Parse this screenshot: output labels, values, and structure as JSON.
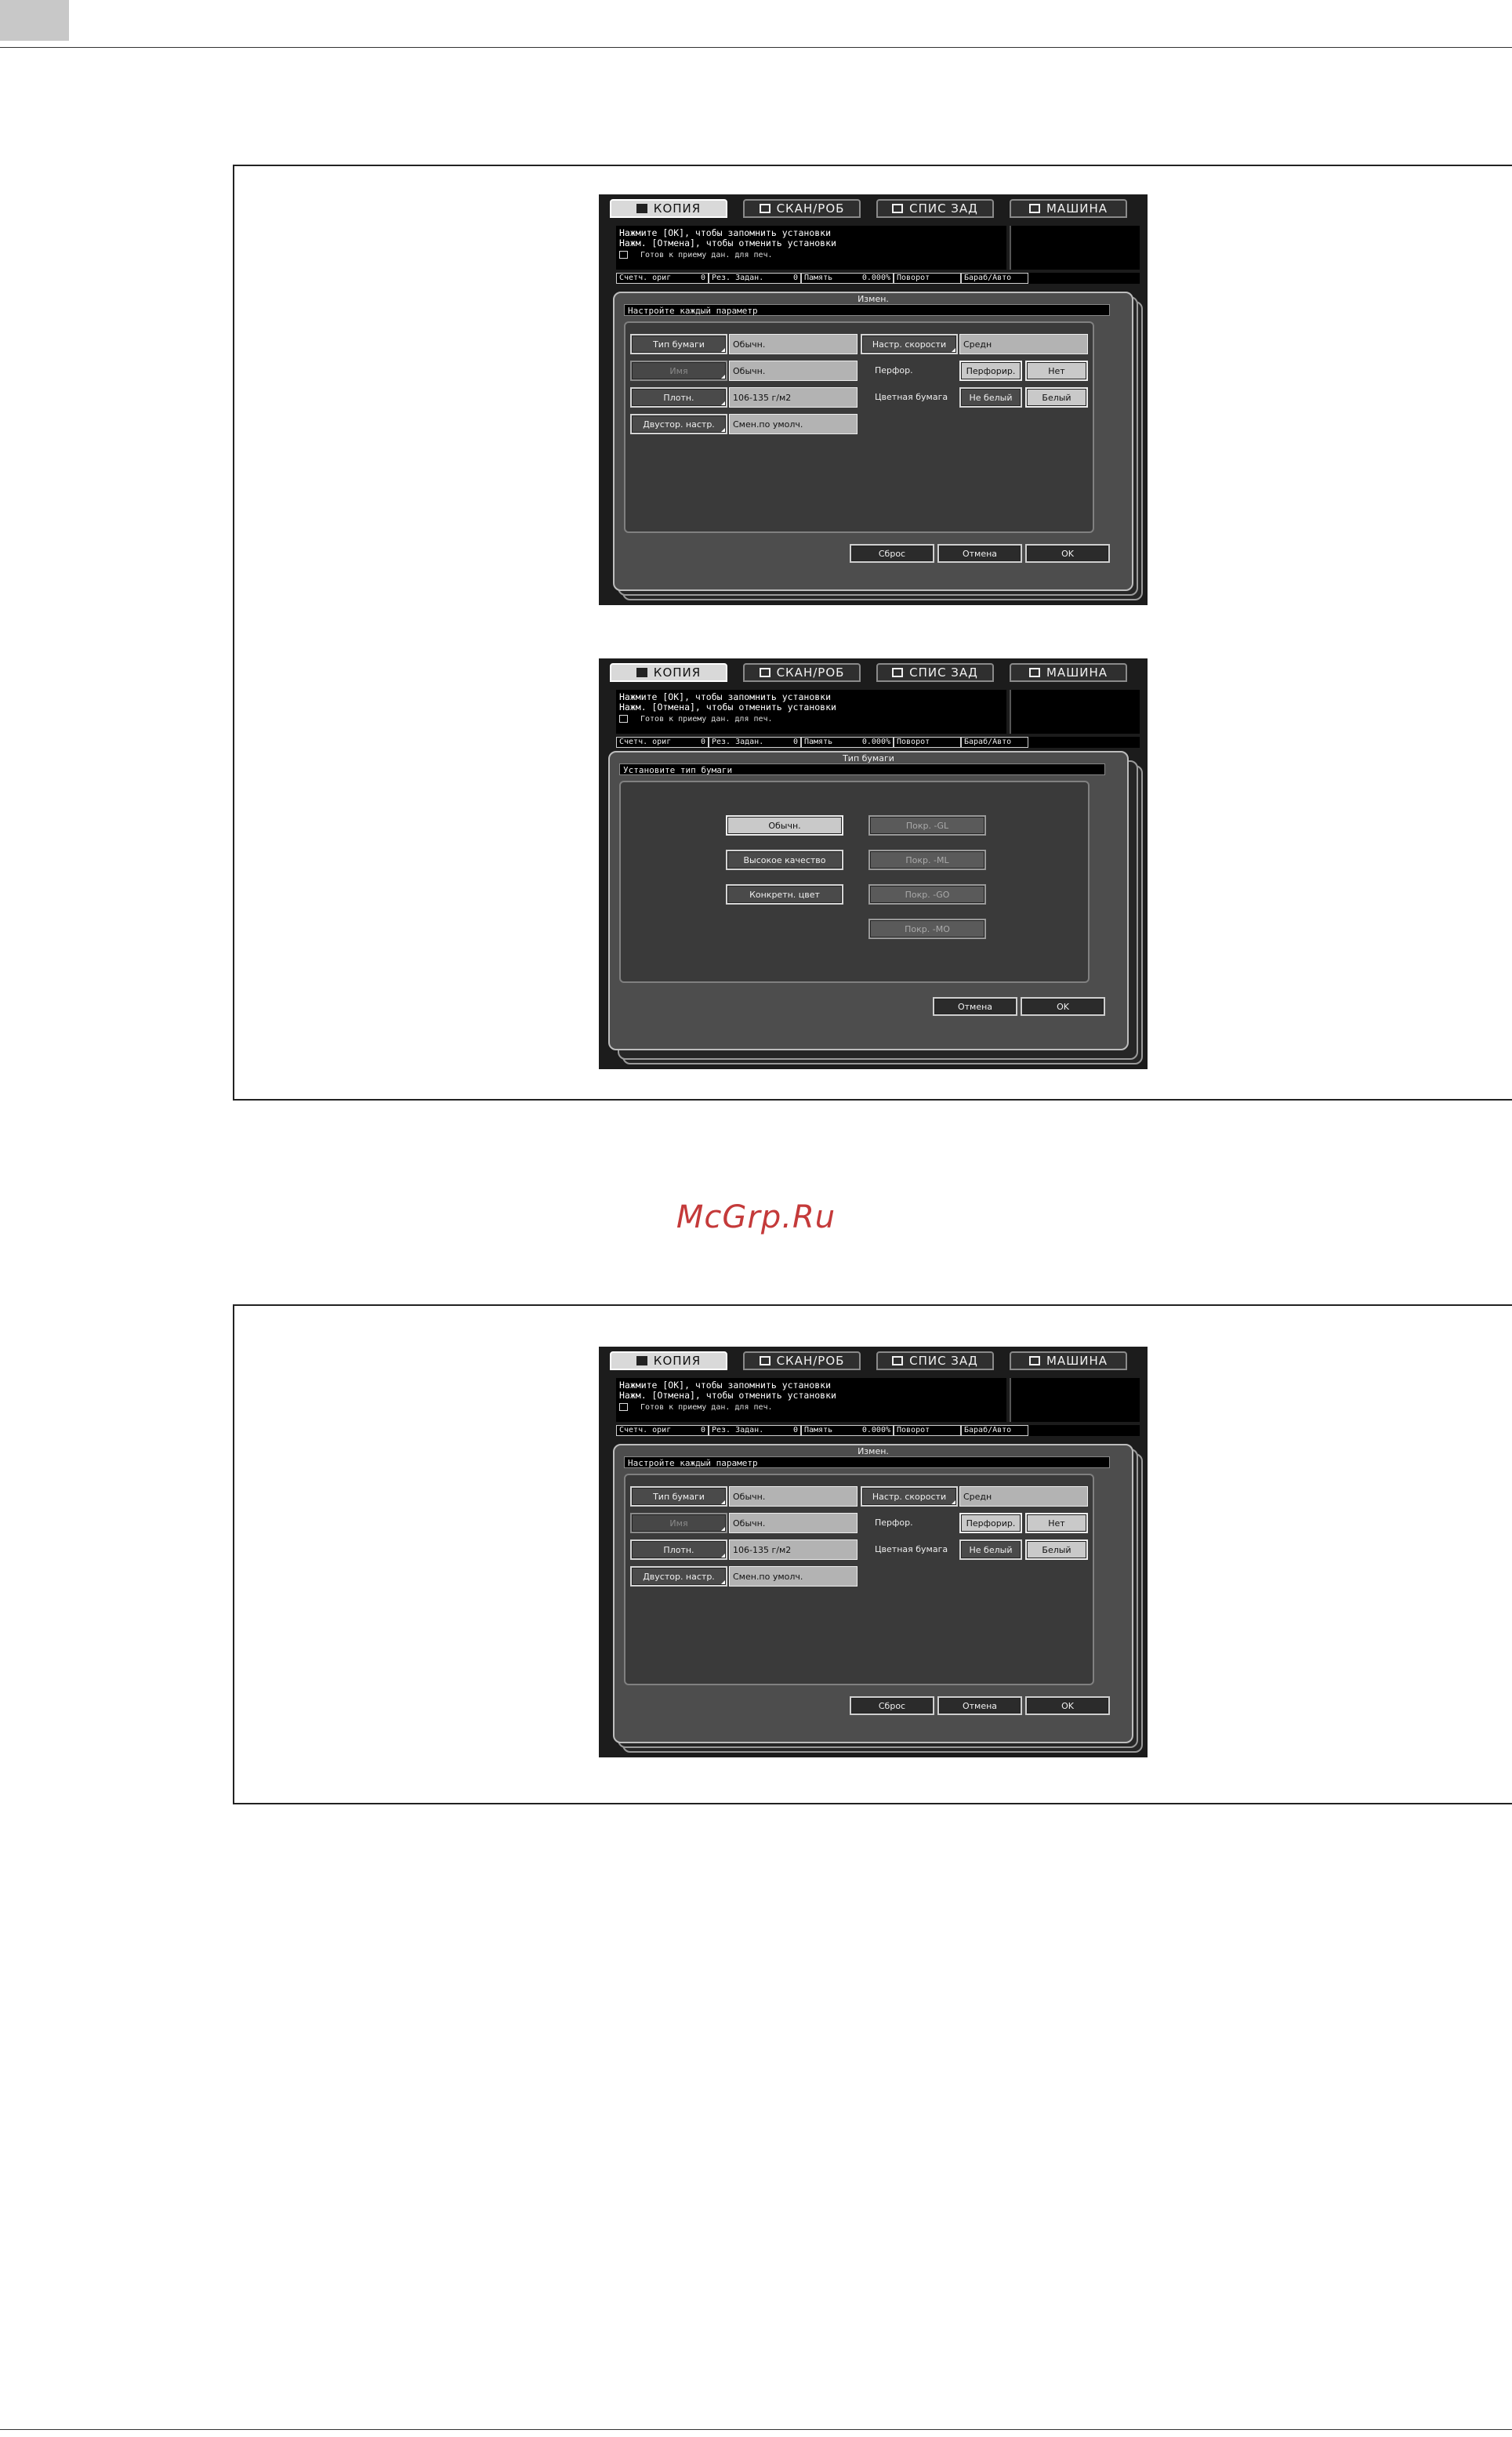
{
  "panels": [
    {
      "tabs": [
        {
          "label": "КОПИЯ",
          "icon": "copy-icon",
          "active": true
        },
        {
          "label": "СКАН/РОБ",
          "icon": "scan-icon",
          "active": false
        },
        {
          "label": "СПИС ЗАД",
          "icon": "job-list-icon",
          "active": false
        },
        {
          "label": "МАШИНА",
          "icon": "machine-icon",
          "active": false
        }
      ],
      "messages": {
        "line1": "Нажмите [OK], чтобы запомнить установки",
        "line2": "Нажм. [Отмена], чтобы отменить установки",
        "status": "Готов к приему дан. для печ."
      },
      "statusbar": {
        "orig_label": "Счетч. ориг",
        "orig_value": "0",
        "jobs_label": "Рез. Задан.",
        "jobs_value": "0",
        "memory_label": "Память",
        "memory_value": "0.000%",
        "rotate_label": "Поворот",
        "drum_label": "Бараб/Авто"
      },
      "dialog": {
        "title": "Измен.",
        "instruction": "Настройте каждый параметр",
        "rows": [
          {
            "button": "Тип бумаги",
            "value": "Обычн."
          },
          {
            "button": "Имя",
            "value": "Обычн."
          },
          {
            "button": "Плотн.",
            "value": "106-135 г/м2"
          },
          {
            "button": "Двустор. настр.",
            "value": "Смен.по умолч."
          }
        ],
        "speed_button": "Настр. скорости",
        "speed_value": "Средн",
        "punch_label": "Перфор.",
        "punch_option1": "Перфорир.",
        "punch_option2": "Нет",
        "color_label": "Цветная бумага",
        "color_option1": "Не белый",
        "color_option2": "Белый",
        "reset": "Сброс",
        "cancel": "Отмена",
        "ok": "OK"
      }
    },
    {
      "tabs": [
        {
          "label": "КОПИЯ",
          "icon": "copy-icon",
          "active": true
        },
        {
          "label": "СКАН/РОБ",
          "icon": "scan-icon",
          "active": false
        },
        {
          "label": "СПИС ЗАД",
          "icon": "job-list-icon",
          "active": false
        },
        {
          "label": "МАШИНА",
          "icon": "machine-icon",
          "active": false
        }
      ],
      "messages": {
        "line1": "Нажмите [OK], чтобы запомнить установки",
        "line2": "Нажм. [Отмена], чтобы отменить установки",
        "status": "Готов к приему дан. для печ."
      },
      "statusbar": {
        "orig_label": "Счетч. ориг",
        "orig_value": "0",
        "jobs_label": "Рез. Задан.",
        "jobs_value": "0",
        "memory_label": "Память",
        "memory_value": "0.000%",
        "rotate_label": "Поворот",
        "drum_label": "Бараб/Авто"
      },
      "dialog": {
        "title": "Тип бумаги",
        "instruction": "Установите тип бумаги",
        "types_left": [
          "Обычн.",
          "Высокое качество",
          "Конкретн. цвет"
        ],
        "types_right": [
          "Покр. -GL",
          "Покр. -ML",
          "Покр. -GO",
          "Покр. -MO"
        ],
        "cancel": "Отмена",
        "ok": "OK"
      }
    },
    {
      "tabs": [
        {
          "label": "КОПИЯ",
          "icon": "copy-icon",
          "active": true
        },
        {
          "label": "СКАН/РОБ",
          "icon": "scan-icon",
          "active": false
        },
        {
          "label": "СПИС ЗАД",
          "icon": "job-list-icon",
          "active": false
        },
        {
          "label": "МАШИНА",
          "icon": "machine-icon",
          "active": false
        }
      ],
      "messages": {
        "line1": "Нажмите [OK], чтобы запомнить установки",
        "line2": "Нажм. [Отмена], чтобы отменить установки",
        "status": "Готов к приему дан. для печ."
      },
      "statusbar": {
        "orig_label": "Счетч. ориг",
        "orig_value": "0",
        "jobs_label": "Рез. Задан.",
        "jobs_value": "0",
        "memory_label": "Память",
        "memory_value": "0.000%",
        "rotate_label": "Поворот",
        "drum_label": "Бараб/Авто"
      },
      "dialog": {
        "title": "Измен.",
        "instruction": "Настройте каждый параметр",
        "rows": [
          {
            "button": "Тип бумаги",
            "value": "Обычн."
          },
          {
            "button": "Имя",
            "value": "Обычн."
          },
          {
            "button": "Плотн.",
            "value": "106-135 г/м2"
          },
          {
            "button": "Двустор. настр.",
            "value": "Смен.по умолч."
          }
        ],
        "speed_button": "Настр. скорости",
        "speed_value": "Средн",
        "punch_label": "Перфор.",
        "punch_option1": "Перфорир.",
        "punch_option2": "Нет",
        "color_label": "Цветная бумага",
        "color_option1": "Не белый",
        "color_option2": "Белый",
        "reset": "Сброс",
        "cancel": "Отмена",
        "ok": "OK"
      }
    }
  ],
  "watermark": "McGrp.Ru"
}
